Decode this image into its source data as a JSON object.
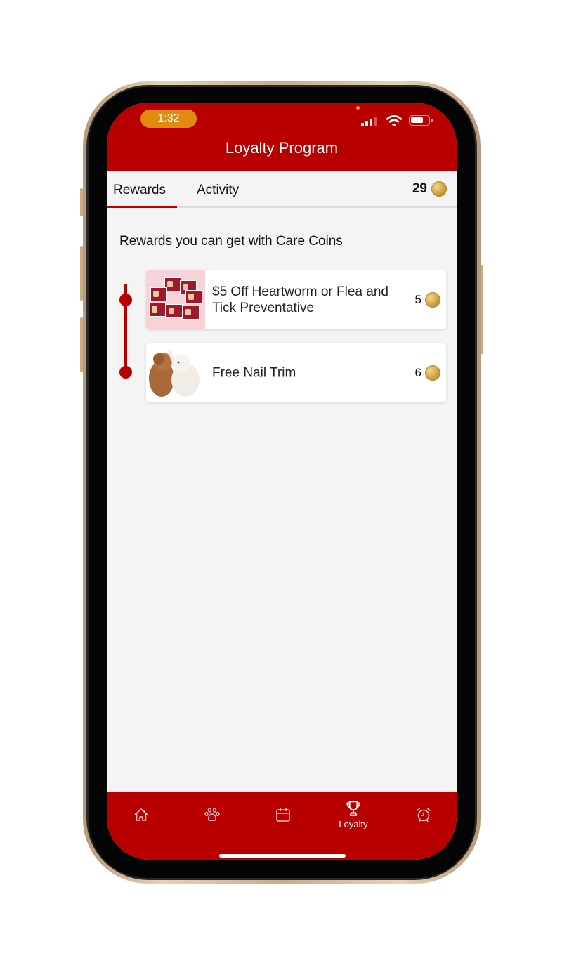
{
  "status_bar": {
    "time": "1:32"
  },
  "header": {
    "title": "Loyalty Program"
  },
  "tabs": [
    {
      "label": "Rewards",
      "active": true
    },
    {
      "label": "Activity",
      "active": false
    }
  ],
  "coin_balance": "29",
  "section_title": "Rewards you can get with Care Coins",
  "rewards": [
    {
      "title": "$5 Off Heartworm or Flea and Tick Preventative",
      "cost": "5",
      "image": "flea-tick-product-boxes"
    },
    {
      "title": "Free Nail Trim",
      "cost": "6",
      "image": "puppy-and-kitten"
    }
  ],
  "bottom_nav": [
    {
      "icon": "home-icon",
      "label": ""
    },
    {
      "icon": "paw-icon",
      "label": ""
    },
    {
      "icon": "calendar-icon",
      "label": ""
    },
    {
      "icon": "trophy-icon",
      "label": "Loyalty",
      "active": true
    },
    {
      "icon": "alarm-clock-icon",
      "label": ""
    }
  ],
  "colors": {
    "brand_red": "#b80000",
    "time_pill": "#e08a0f",
    "coin_gold": "#c99a3c"
  }
}
